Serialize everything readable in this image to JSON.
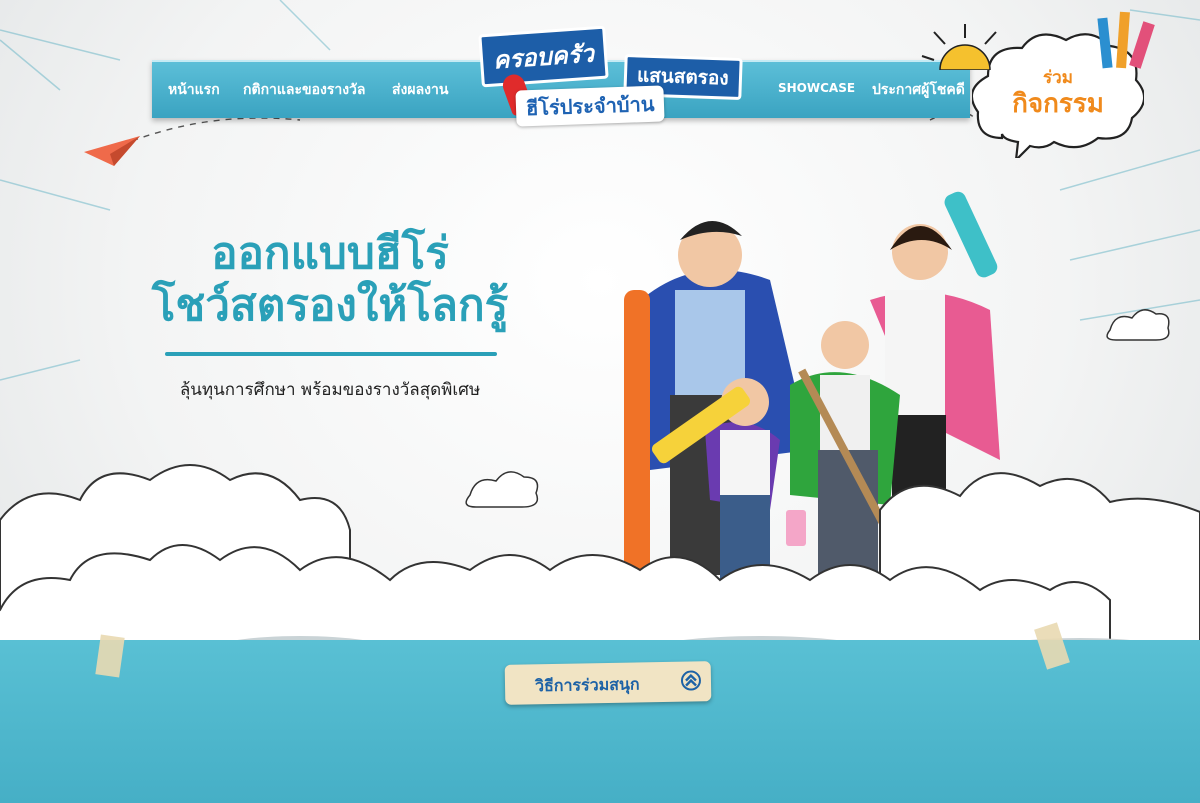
{
  "logo": {
    "line1": "ครอบครัว",
    "line2": "แสนสตรอง",
    "line3": "ฮีโร่ประจำบ้าน"
  },
  "nav": {
    "home": "หน้าแรก",
    "rules": "กติกาและของรางวัล",
    "submit": "ส่งผลงาน",
    "showcase": "SHOWCASE",
    "winners": "ประกาศผู้โชคดี"
  },
  "cta": {
    "line1": "ร่วม",
    "line2": "กิจกรรม"
  },
  "hero": {
    "headline1": "ออกแบบฮีโร่",
    "headline2": "โชว์สตรองให้โลกรู้",
    "subtitle": "ลุ้นทุนการศึกษา พร้อมของรางวัลสุดพิเศษ"
  },
  "how_to_button": "วิธีการร่วมสนุก",
  "icons": [
    "paper-plane-icon",
    "sun-icon",
    "pencil-icon",
    "crayon-icon",
    "chevron-up-icon",
    "cloud-icon"
  ],
  "colors": {
    "nav": "#3aa3c1",
    "headline": "#2aa0b8",
    "cta_text": "#f08a1c",
    "logo_blue": "#1d5ea8",
    "sky": "#4fb8cd"
  }
}
